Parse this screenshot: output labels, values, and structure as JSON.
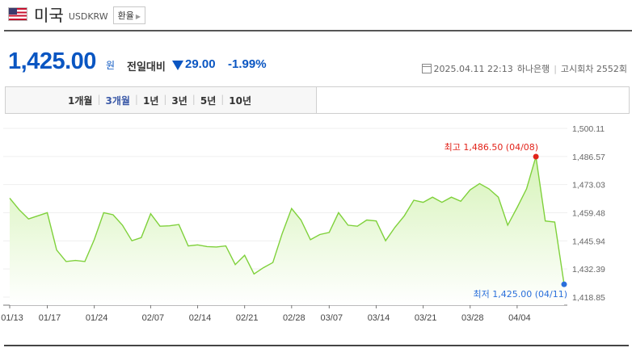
{
  "header": {
    "flag_icon": "us-flag-icon",
    "country": "미국",
    "code": "USDKRW",
    "exchange_button": "환율"
  },
  "quote": {
    "price": "1,425.00",
    "unit": "원",
    "compare_label": "전일대비",
    "change": "29.00",
    "change_pct": "-1.99%",
    "direction": "down",
    "datetime": "2025.04.11 22:13",
    "bank": "하나은행",
    "notice": "고시회차 2552회"
  },
  "tabs": [
    {
      "label": "1개월",
      "active": false
    },
    {
      "label": "3개월",
      "active": true
    },
    {
      "label": "1년",
      "active": false
    },
    {
      "label": "3년",
      "active": false
    },
    {
      "label": "5년",
      "active": false
    },
    {
      "label": "10년",
      "active": false
    }
  ],
  "colors": {
    "accent_blue": "#0a56c2",
    "line": "#7fd13b",
    "fill_top": "#d6f3b8",
    "high": "#e2231a",
    "low": "#2a6fdb"
  },
  "chart_data": {
    "type": "area",
    "y_ticks": [
      "1,500.11",
      "1,486.57",
      "1,473.03",
      "1,459.48",
      "1,445.94",
      "1,432.39",
      "1,418.85"
    ],
    "ylim": [
      1418.85,
      1500.11
    ],
    "x_labels": [
      "01/13",
      "01/17",
      "01/24",
      "02/07",
      "02/14",
      "02/21",
      "02/28",
      "03/07",
      "03/14",
      "03/21",
      "03/28",
      "04/04"
    ],
    "x_label_index": [
      0,
      4,
      9,
      15,
      20,
      25,
      30,
      34,
      39,
      44,
      49,
      54
    ],
    "values": [
      1466.5,
      1461,
      1456.5,
      1458,
      1459.5,
      1441.5,
      1436,
      1436.5,
      1436,
      1446.5,
      1459.5,
      1458.5,
      1453.5,
      1446,
      1447.5,
      1459,
      1453,
      1453.2,
      1453.8,
      1443.5,
      1444,
      1443.2,
      1443,
      1443.5,
      1434.5,
      1439,
      1430,
      1433,
      1435.5,
      1449.5,
      1461.5,
      1456,
      1446.5,
      1449,
      1450,
      1459.5,
      1453.5,
      1453,
      1456,
      1455.5,
      1446,
      1452.5,
      1458,
      1465.5,
      1464.5,
      1467,
      1464.5,
      1467,
      1465,
      1470.5,
      1473.5,
      1471,
      1467,
      1453.5,
      1462,
      1471,
      1486.5,
      1455.5,
      1455,
      1425
    ],
    "high": {
      "label": "최고 1,486.50 (04/08)",
      "index": 56,
      "value": 1486.5
    },
    "low": {
      "label": "최저 1,425.00 (04/11)",
      "index": 59,
      "value": 1425
    }
  }
}
